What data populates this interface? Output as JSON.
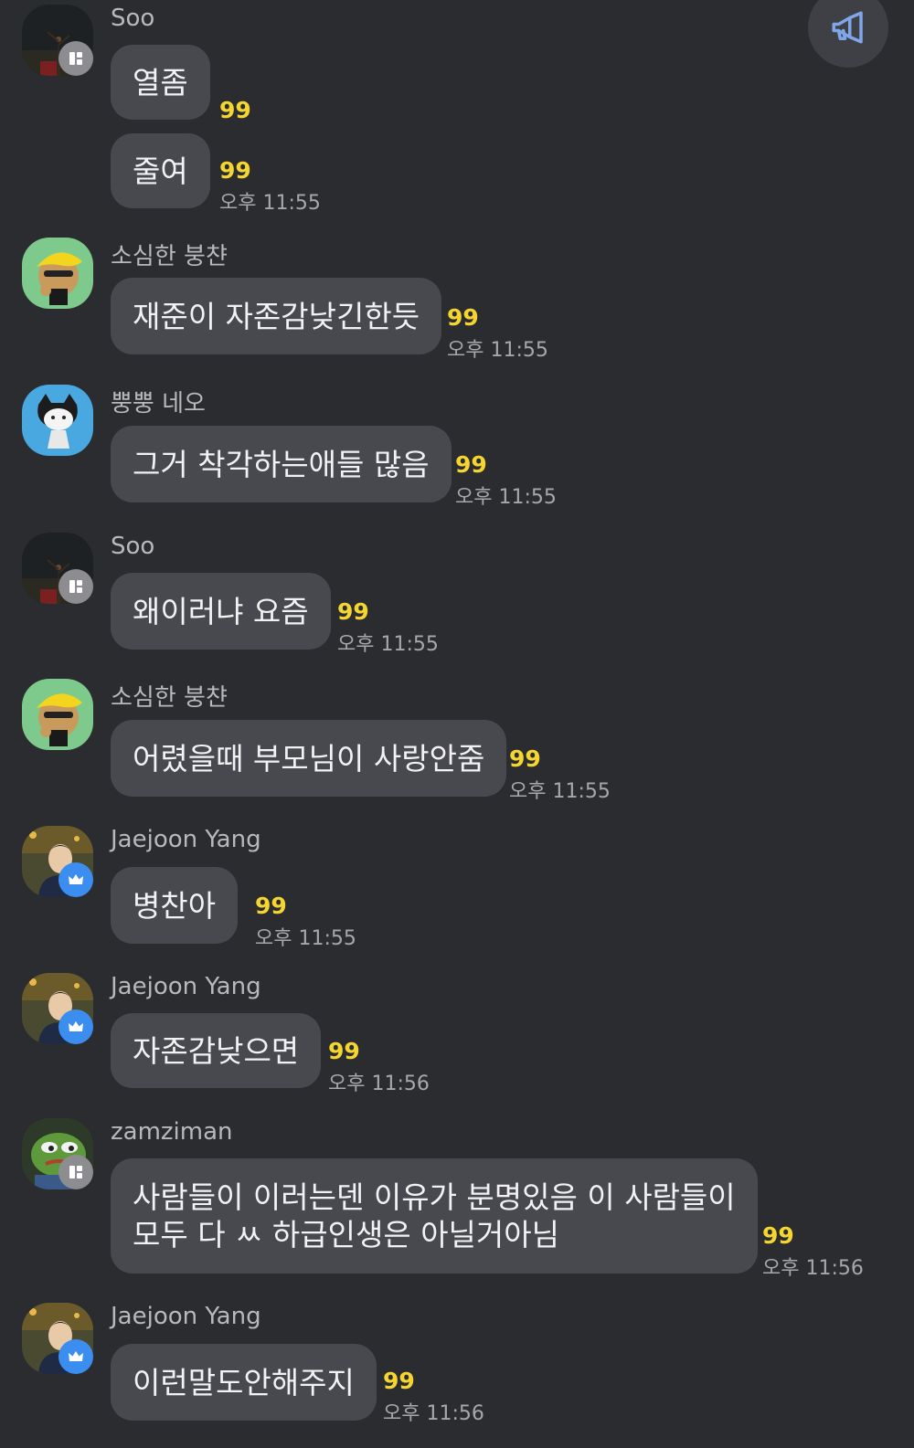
{
  "messages": [
    {
      "sender": "Soo",
      "text": "열좀",
      "unread": "99",
      "time": ""
    },
    {
      "sender": "",
      "text": "줄여",
      "unread": "99",
      "time": "오후 11:55"
    },
    {
      "sender": "소심한 붕챤",
      "text": "재준이 자존감낮긴한듯",
      "unread": "99",
      "time": "오후 11:55"
    },
    {
      "sender": "뿡뿡 네오",
      "text": "그거 착각하는애들 많음",
      "unread": "99",
      "time": "오후 11:55"
    },
    {
      "sender": "Soo",
      "text": "왜이러냐 요즘",
      "unread": "99",
      "time": "오후 11:55"
    },
    {
      "sender": "소심한 붕챤",
      "text": "어렸을때 부모님이 사랑안줌",
      "unread": "99",
      "time": "오후 11:55"
    },
    {
      "sender": "Jaejoon Yang",
      "text": "병찬아",
      "unread": "99",
      "time": "오후 11:55"
    },
    {
      "sender": "Jaejoon Yang",
      "text": "자존감낮으면",
      "unread": "99",
      "time": "오후 11:56"
    },
    {
      "sender": "zamziman",
      "text_line1": "사람들이 이러는덴 이유가 분명있음 이 사람들이",
      "text_line2": "모두 다 ㅆ 하급인생은 아닐거아님",
      "unread": "99",
      "time": "오후 11:56"
    },
    {
      "sender": "Jaejoon Yang",
      "text": "이런말도안해주지",
      "unread": "99",
      "time": "오후 11:56"
    }
  ],
  "icons": {
    "notice": "megaphone-icon",
    "staff_badge": "manager-badge-icon",
    "host_badge": "crown-icon"
  },
  "colors": {
    "background": "#2b2c30",
    "bubble": "#48494e",
    "unread": "#f5d630",
    "host_badge": "#3b8ef0"
  }
}
